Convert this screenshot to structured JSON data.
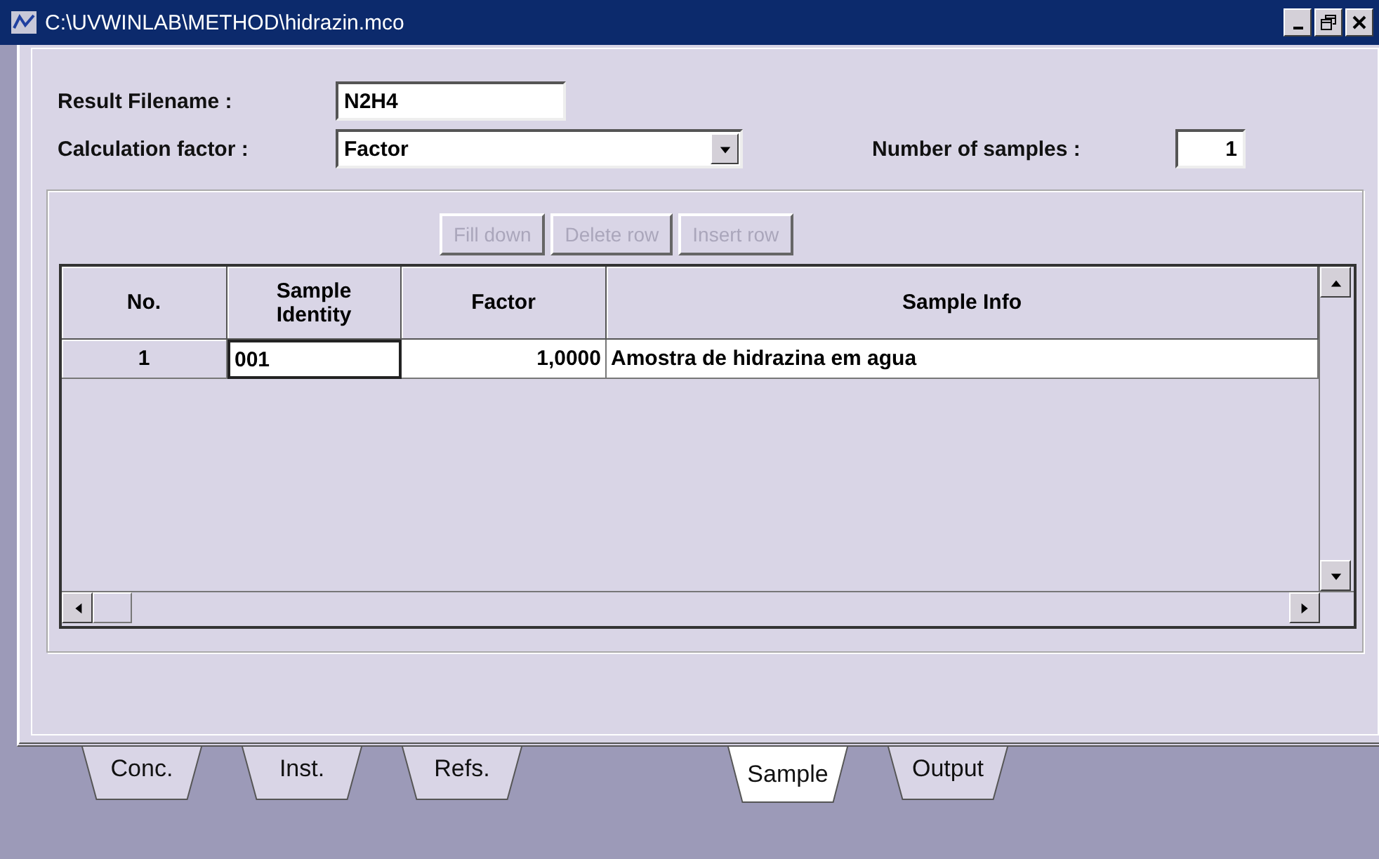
{
  "window": {
    "title": "C:\\UVWINLAB\\METHOD\\hidrazin.mco"
  },
  "form": {
    "result_filename": {
      "label": "Result Filename :",
      "value": "N2H4"
    },
    "calculation_factor": {
      "label": "Calculation factor :",
      "value": "Factor"
    },
    "number_of_samples": {
      "label": "Number of samples :",
      "value": "1"
    }
  },
  "toolbar": [
    {
      "label": "Fill down",
      "disabled": true
    },
    {
      "label": "Delete row",
      "disabled": true
    },
    {
      "label": "Insert row",
      "disabled": true
    }
  ],
  "table": {
    "columns": [
      "No.",
      "Sample Identity",
      "Factor",
      "Sample Info"
    ],
    "rows": [
      [
        "1",
        "001",
        "1,0000",
        "Amostra de hidrazina em agua"
      ]
    ]
  },
  "tabs": [
    {
      "label": "Conc.",
      "selected": false
    },
    {
      "label": "Inst.",
      "selected": false
    },
    {
      "label": "Refs.",
      "selected": false
    },
    {
      "label": "Sample",
      "selected": true
    },
    {
      "label": "Output",
      "selected": false
    }
  ]
}
